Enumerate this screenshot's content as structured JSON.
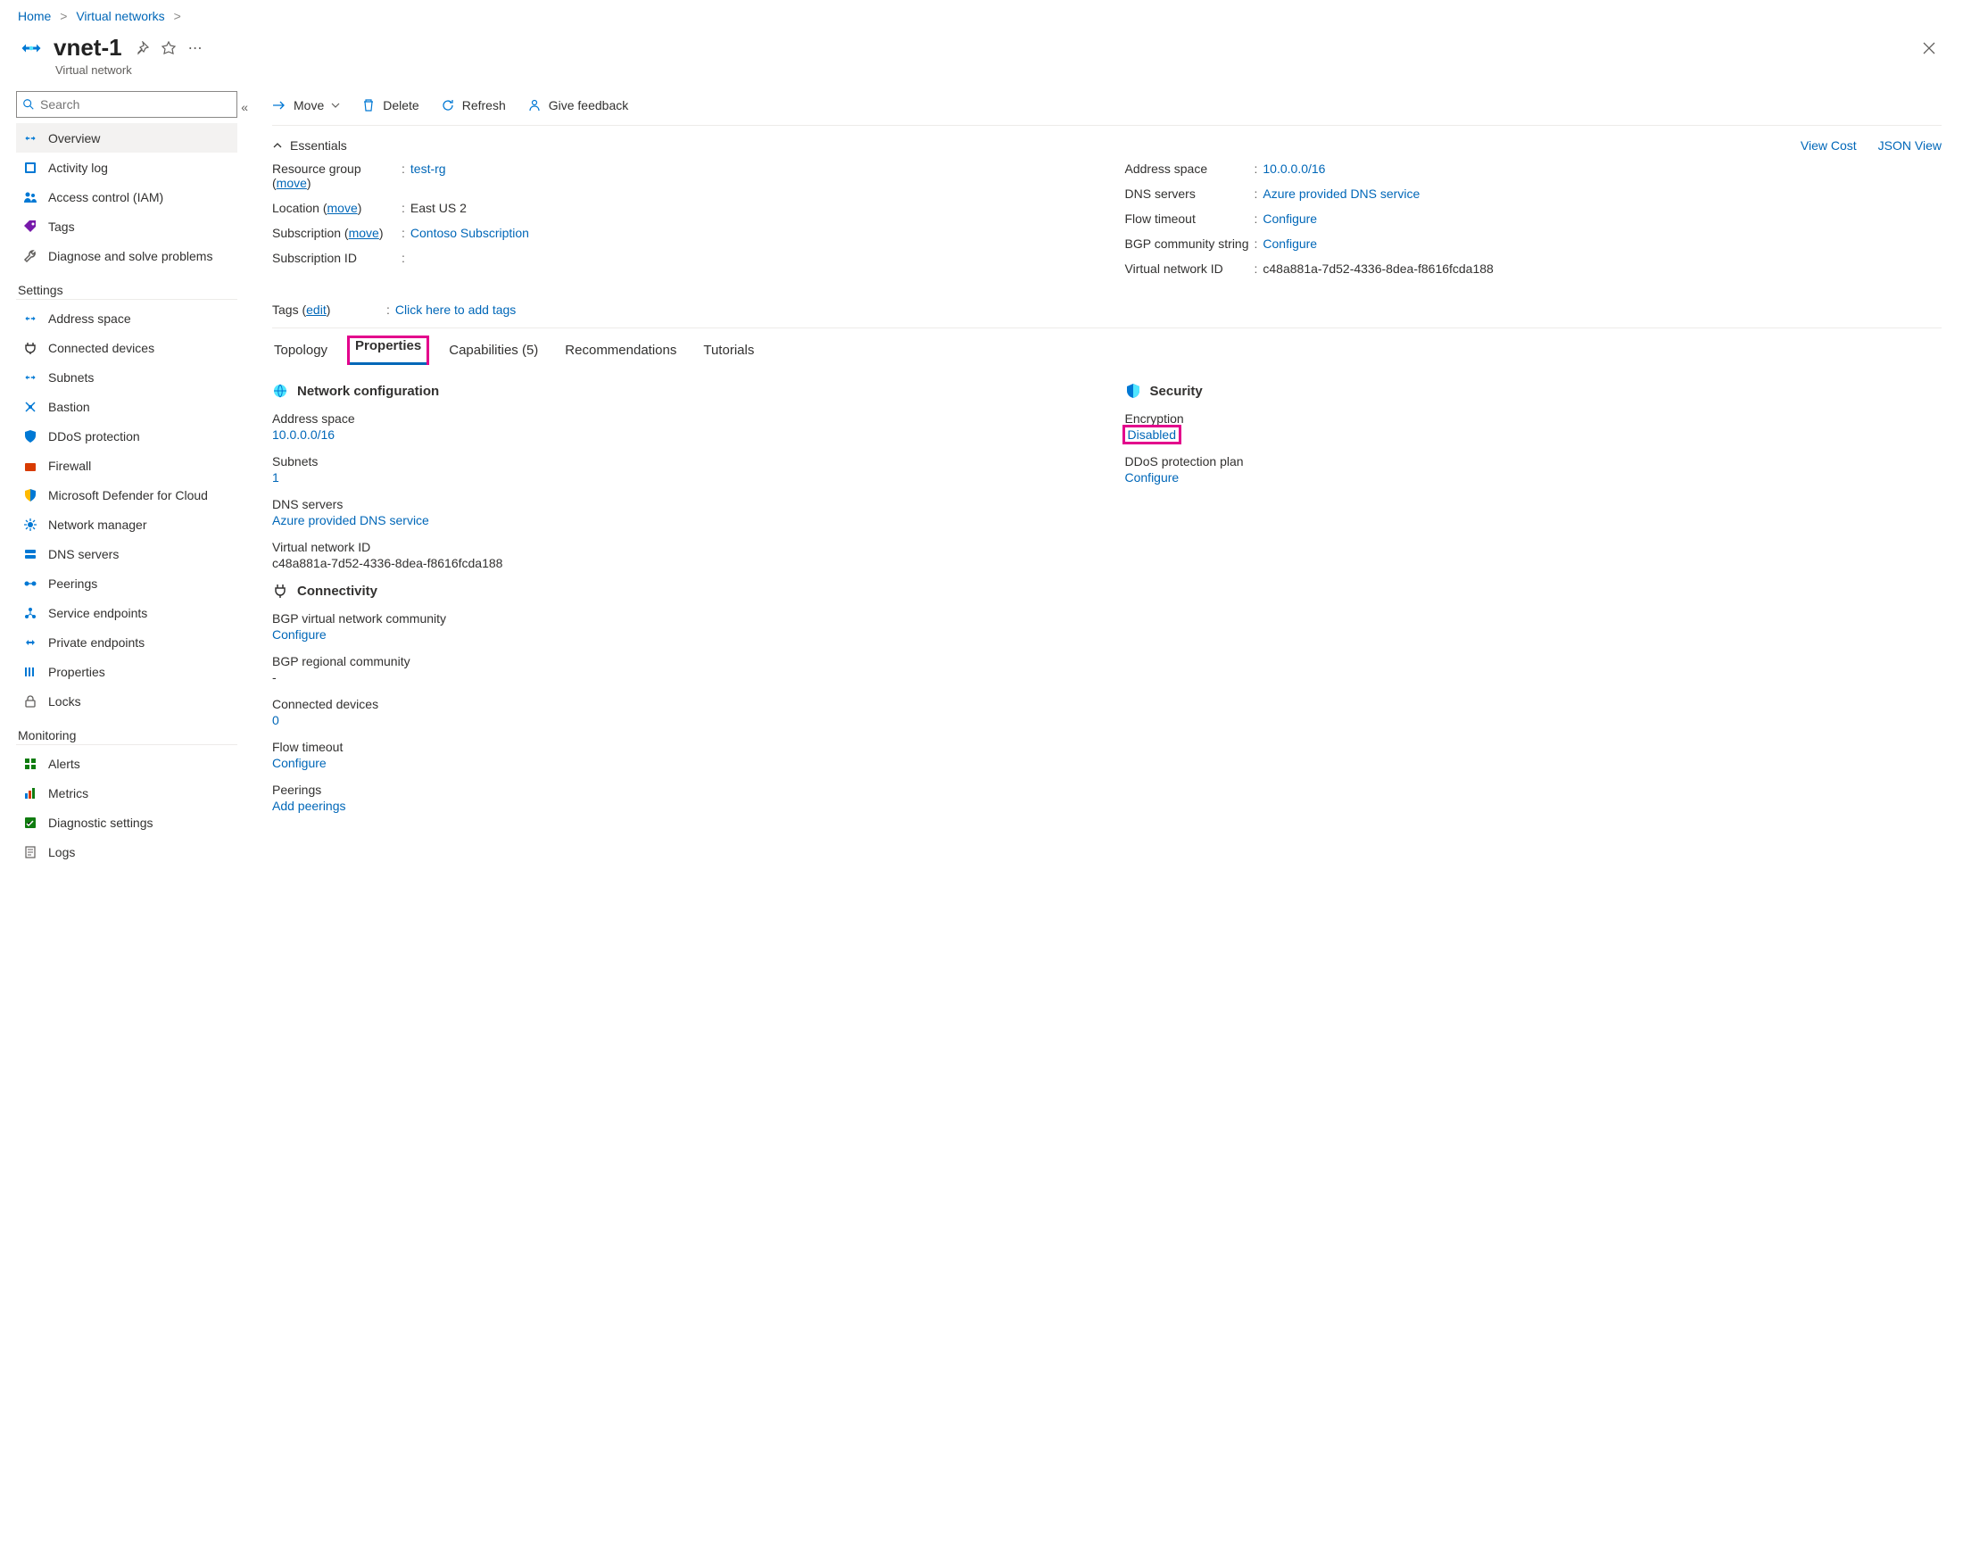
{
  "breadcrumb": {
    "home": "Home",
    "vn": "Virtual networks"
  },
  "page": {
    "title": "vnet-1",
    "subtitle": "Virtual network",
    "search_placeholder": "Search"
  },
  "sidebar": {
    "items": [
      {
        "label": "Overview",
        "icon": "vnet-icon",
        "active": true
      },
      {
        "label": "Activity log",
        "icon": "log-icon"
      },
      {
        "label": "Access control (IAM)",
        "icon": "people-icon"
      },
      {
        "label": "Tags",
        "icon": "tag-icon"
      },
      {
        "label": "Diagnose and solve problems",
        "icon": "wrench-icon"
      }
    ],
    "settings_header": "Settings",
    "settings": [
      {
        "label": "Address space",
        "icon": "vnet-icon"
      },
      {
        "label": "Connected devices",
        "icon": "plug-icon"
      },
      {
        "label": "Subnets",
        "icon": "vnet-icon"
      },
      {
        "label": "Bastion",
        "icon": "bastion-icon"
      },
      {
        "label": "DDoS protection",
        "icon": "shield-icon"
      },
      {
        "label": "Firewall",
        "icon": "firewall-icon"
      },
      {
        "label": "Microsoft Defender for Cloud",
        "icon": "defender-icon"
      },
      {
        "label": "Network manager",
        "icon": "netmgr-icon"
      },
      {
        "label": "DNS servers",
        "icon": "dns-icon"
      },
      {
        "label": "Peerings",
        "icon": "peer-icon"
      },
      {
        "label": "Service endpoints",
        "icon": "endpoints-icon"
      },
      {
        "label": "Private endpoints",
        "icon": "private-ep-icon"
      },
      {
        "label": "Properties",
        "icon": "properties-icon"
      },
      {
        "label": "Locks",
        "icon": "lock-icon"
      }
    ],
    "monitoring_header": "Monitoring",
    "monitoring": [
      {
        "label": "Alerts",
        "icon": "grid-icon"
      },
      {
        "label": "Metrics",
        "icon": "chart-icon"
      },
      {
        "label": "Diagnostic settings",
        "icon": "diag-icon"
      },
      {
        "label": "Logs",
        "icon": "logs-icon"
      }
    ]
  },
  "toolbar": {
    "move": "Move",
    "delete": "Delete",
    "refresh": "Refresh",
    "feedback": "Give feedback"
  },
  "essentials": {
    "header": "Essentials",
    "view_cost": "View Cost",
    "json_view": "JSON View",
    "move_link": "move",
    "edit_link": "edit",
    "left": {
      "rg_label": "Resource group",
      "rg_value": "test-rg",
      "loc_label": "Location",
      "loc_value": "East US 2",
      "sub_label": "Subscription",
      "sub_value": "Contoso Subscription",
      "subid_label": "Subscription ID",
      "subid_value": ""
    },
    "right": {
      "addr_label": "Address space",
      "addr_value": "10.0.0.0/16",
      "dns_label": "DNS servers",
      "dns_value": "Azure provided DNS service",
      "flow_label": "Flow timeout",
      "flow_value": "Configure",
      "bgp_label": "BGP community string",
      "bgp_value": "Configure",
      "vnid_label": "Virtual network ID",
      "vnid_value": "c48a881a-7d52-4336-8dea-f8616fcda188"
    },
    "tags_label": "Tags",
    "tags_value": "Click here to add tags"
  },
  "tabs": {
    "topology": "Topology",
    "properties": "Properties",
    "capabilities": "Capabilities (5)",
    "recommendations": "Recommendations",
    "tutorials": "Tutorials"
  },
  "props": {
    "netconf_header": "Network configuration",
    "addr_label": "Address space",
    "addr_value": "10.0.0.0/16",
    "subnets_label": "Subnets",
    "subnets_value": "1",
    "dns_label": "DNS servers",
    "dns_value": "Azure provided DNS service",
    "vnid_label": "Virtual network ID",
    "vnid_value": "c48a881a-7d52-4336-8dea-f8616fcda188",
    "conn_header": "Connectivity",
    "bgpvn_label": "BGP virtual network community",
    "bgpvn_value": "Configure",
    "bgpr_label": "BGP regional community",
    "bgpr_value": "-",
    "cdev_label": "Connected devices",
    "cdev_value": "0",
    "flow_label": "Flow timeout",
    "flow_value": "Configure",
    "peer_label": "Peerings",
    "peer_value": "Add peerings",
    "sec_header": "Security",
    "enc_label": "Encryption",
    "enc_value": "Disabled",
    "ddos_label": "DDoS protection plan",
    "ddos_value": "Configure"
  }
}
